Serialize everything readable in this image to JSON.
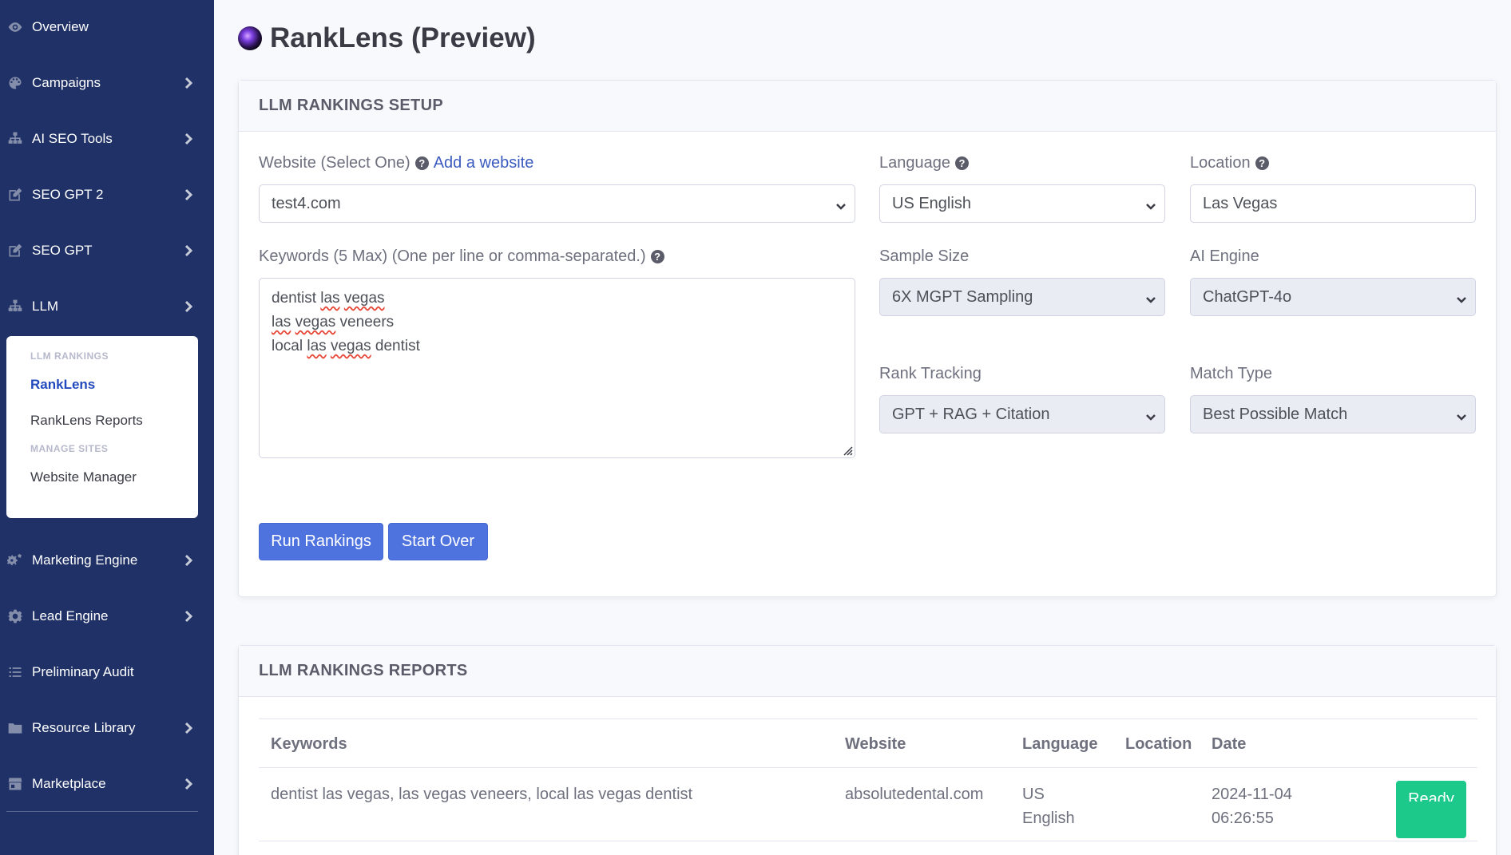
{
  "sidebar": {
    "items": [
      {
        "label": "Overview",
        "icon": "eye-icon"
      },
      {
        "label": "Campaigns",
        "icon": "palette-icon"
      },
      {
        "label": "AI SEO Tools",
        "icon": "sitemap-icon"
      },
      {
        "label": "SEO GPT 2",
        "icon": "edit-icon"
      },
      {
        "label": "SEO GPT",
        "icon": "edit-icon"
      },
      {
        "label": "LLM",
        "icon": "sitemap-icon"
      },
      {
        "label": "Marketing Engine",
        "icon": "cogs-icon"
      },
      {
        "label": "Lead Engine",
        "icon": "gear-icon"
      },
      {
        "label": "Preliminary Audit",
        "icon": "list-icon"
      },
      {
        "label": "Resource Library",
        "icon": "folder-icon"
      },
      {
        "label": "Marketplace",
        "icon": "store-icon"
      }
    ],
    "submenu": {
      "header1": "LLM RANKINGS",
      "link1": "RankLens",
      "link2": "RankLens Reports",
      "header2": "MANAGE SITES",
      "link3": "Website Manager"
    }
  },
  "page": {
    "title": "RankLens (Preview)"
  },
  "setup": {
    "header": "LLM RANKINGS SETUP",
    "website_label": "Website (Select One)",
    "add_website": "Add a website",
    "website_value": "test4.com",
    "language_label": "Language",
    "language_value": "US English",
    "location_label": "Location",
    "location_value": "Las Vegas",
    "keywords_label": "Keywords (5 Max) (One per line or comma-separated.)",
    "keywords": {
      "k1a": "dentist ",
      "k1b": "las",
      "k1c": " ",
      "k1d": "vegas",
      "k2a": "las",
      "k2b": " ",
      "k2c": "vegas",
      "k2d": " veneers",
      "k3a": "local ",
      "k3b": "las",
      "k3c": " ",
      "k3d": "vegas",
      "k3e": " dentist"
    },
    "sample_size_label": "Sample Size",
    "sample_size_value": "6X MGPT Sampling",
    "ai_engine_label": "AI Engine",
    "ai_engine_value": "ChatGPT-4o",
    "rank_tracking_label": "Rank Tracking",
    "rank_tracking_value": "GPT + RAG + Citation",
    "match_type_label": "Match Type",
    "match_type_value": "Best Possible Match",
    "run_button": "Run Rankings",
    "start_over_button": "Start Over"
  },
  "reports": {
    "header": "LLM RANKINGS REPORTS",
    "columns": {
      "keywords": "Keywords",
      "website": "Website",
      "language": "Language",
      "location": "Location",
      "date": "Date"
    },
    "rows": [
      {
        "keywords": "dentist las vegas, las vegas veneers, local las vegas dentist",
        "website": "absolutedental.com",
        "language_line1": "US",
        "language_line2": "English",
        "location": "",
        "date_line1": "2024-11-04",
        "date_line2": "06:26:55",
        "status": "Ready"
      }
    ]
  },
  "colors": {
    "sidebar_bg": "#1f3166",
    "primary": "#4e73df",
    "success": "#1cc88a",
    "link": "#3b5bbf"
  }
}
